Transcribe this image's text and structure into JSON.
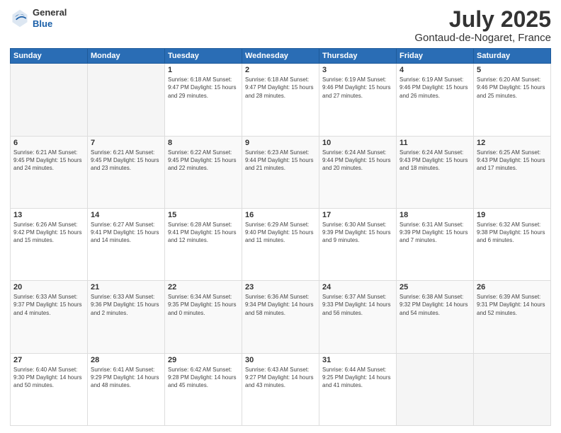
{
  "header": {
    "logo_general": "General",
    "logo_blue": "Blue",
    "month": "July 2025",
    "location": "Gontaud-de-Nogaret, France"
  },
  "weekdays": [
    "Sunday",
    "Monday",
    "Tuesday",
    "Wednesday",
    "Thursday",
    "Friday",
    "Saturday"
  ],
  "weeks": [
    [
      {
        "day": "",
        "info": ""
      },
      {
        "day": "",
        "info": ""
      },
      {
        "day": "1",
        "info": "Sunrise: 6:18 AM\nSunset: 9:47 PM\nDaylight: 15 hours\nand 29 minutes."
      },
      {
        "day": "2",
        "info": "Sunrise: 6:18 AM\nSunset: 9:47 PM\nDaylight: 15 hours\nand 28 minutes."
      },
      {
        "day": "3",
        "info": "Sunrise: 6:19 AM\nSunset: 9:46 PM\nDaylight: 15 hours\nand 27 minutes."
      },
      {
        "day": "4",
        "info": "Sunrise: 6:19 AM\nSunset: 9:46 PM\nDaylight: 15 hours\nand 26 minutes."
      },
      {
        "day": "5",
        "info": "Sunrise: 6:20 AM\nSunset: 9:46 PM\nDaylight: 15 hours\nand 25 minutes."
      }
    ],
    [
      {
        "day": "6",
        "info": "Sunrise: 6:21 AM\nSunset: 9:45 PM\nDaylight: 15 hours\nand 24 minutes."
      },
      {
        "day": "7",
        "info": "Sunrise: 6:21 AM\nSunset: 9:45 PM\nDaylight: 15 hours\nand 23 minutes."
      },
      {
        "day": "8",
        "info": "Sunrise: 6:22 AM\nSunset: 9:45 PM\nDaylight: 15 hours\nand 22 minutes."
      },
      {
        "day": "9",
        "info": "Sunrise: 6:23 AM\nSunset: 9:44 PM\nDaylight: 15 hours\nand 21 minutes."
      },
      {
        "day": "10",
        "info": "Sunrise: 6:24 AM\nSunset: 9:44 PM\nDaylight: 15 hours\nand 20 minutes."
      },
      {
        "day": "11",
        "info": "Sunrise: 6:24 AM\nSunset: 9:43 PM\nDaylight: 15 hours\nand 18 minutes."
      },
      {
        "day": "12",
        "info": "Sunrise: 6:25 AM\nSunset: 9:43 PM\nDaylight: 15 hours\nand 17 minutes."
      }
    ],
    [
      {
        "day": "13",
        "info": "Sunrise: 6:26 AM\nSunset: 9:42 PM\nDaylight: 15 hours\nand 15 minutes."
      },
      {
        "day": "14",
        "info": "Sunrise: 6:27 AM\nSunset: 9:41 PM\nDaylight: 15 hours\nand 14 minutes."
      },
      {
        "day": "15",
        "info": "Sunrise: 6:28 AM\nSunset: 9:41 PM\nDaylight: 15 hours\nand 12 minutes."
      },
      {
        "day": "16",
        "info": "Sunrise: 6:29 AM\nSunset: 9:40 PM\nDaylight: 15 hours\nand 11 minutes."
      },
      {
        "day": "17",
        "info": "Sunrise: 6:30 AM\nSunset: 9:39 PM\nDaylight: 15 hours\nand 9 minutes."
      },
      {
        "day": "18",
        "info": "Sunrise: 6:31 AM\nSunset: 9:39 PM\nDaylight: 15 hours\nand 7 minutes."
      },
      {
        "day": "19",
        "info": "Sunrise: 6:32 AM\nSunset: 9:38 PM\nDaylight: 15 hours\nand 6 minutes."
      }
    ],
    [
      {
        "day": "20",
        "info": "Sunrise: 6:33 AM\nSunset: 9:37 PM\nDaylight: 15 hours\nand 4 minutes."
      },
      {
        "day": "21",
        "info": "Sunrise: 6:33 AM\nSunset: 9:36 PM\nDaylight: 15 hours\nand 2 minutes."
      },
      {
        "day": "22",
        "info": "Sunrise: 6:34 AM\nSunset: 9:35 PM\nDaylight: 15 hours\nand 0 minutes."
      },
      {
        "day": "23",
        "info": "Sunrise: 6:36 AM\nSunset: 9:34 PM\nDaylight: 14 hours\nand 58 minutes."
      },
      {
        "day": "24",
        "info": "Sunrise: 6:37 AM\nSunset: 9:33 PM\nDaylight: 14 hours\nand 56 minutes."
      },
      {
        "day": "25",
        "info": "Sunrise: 6:38 AM\nSunset: 9:32 PM\nDaylight: 14 hours\nand 54 minutes."
      },
      {
        "day": "26",
        "info": "Sunrise: 6:39 AM\nSunset: 9:31 PM\nDaylight: 14 hours\nand 52 minutes."
      }
    ],
    [
      {
        "day": "27",
        "info": "Sunrise: 6:40 AM\nSunset: 9:30 PM\nDaylight: 14 hours\nand 50 minutes."
      },
      {
        "day": "28",
        "info": "Sunrise: 6:41 AM\nSunset: 9:29 PM\nDaylight: 14 hours\nand 48 minutes."
      },
      {
        "day": "29",
        "info": "Sunrise: 6:42 AM\nSunset: 9:28 PM\nDaylight: 14 hours\nand 45 minutes."
      },
      {
        "day": "30",
        "info": "Sunrise: 6:43 AM\nSunset: 9:27 PM\nDaylight: 14 hours\nand 43 minutes."
      },
      {
        "day": "31",
        "info": "Sunrise: 6:44 AM\nSunset: 9:25 PM\nDaylight: 14 hours\nand 41 minutes."
      },
      {
        "day": "",
        "info": ""
      },
      {
        "day": "",
        "info": ""
      }
    ]
  ]
}
